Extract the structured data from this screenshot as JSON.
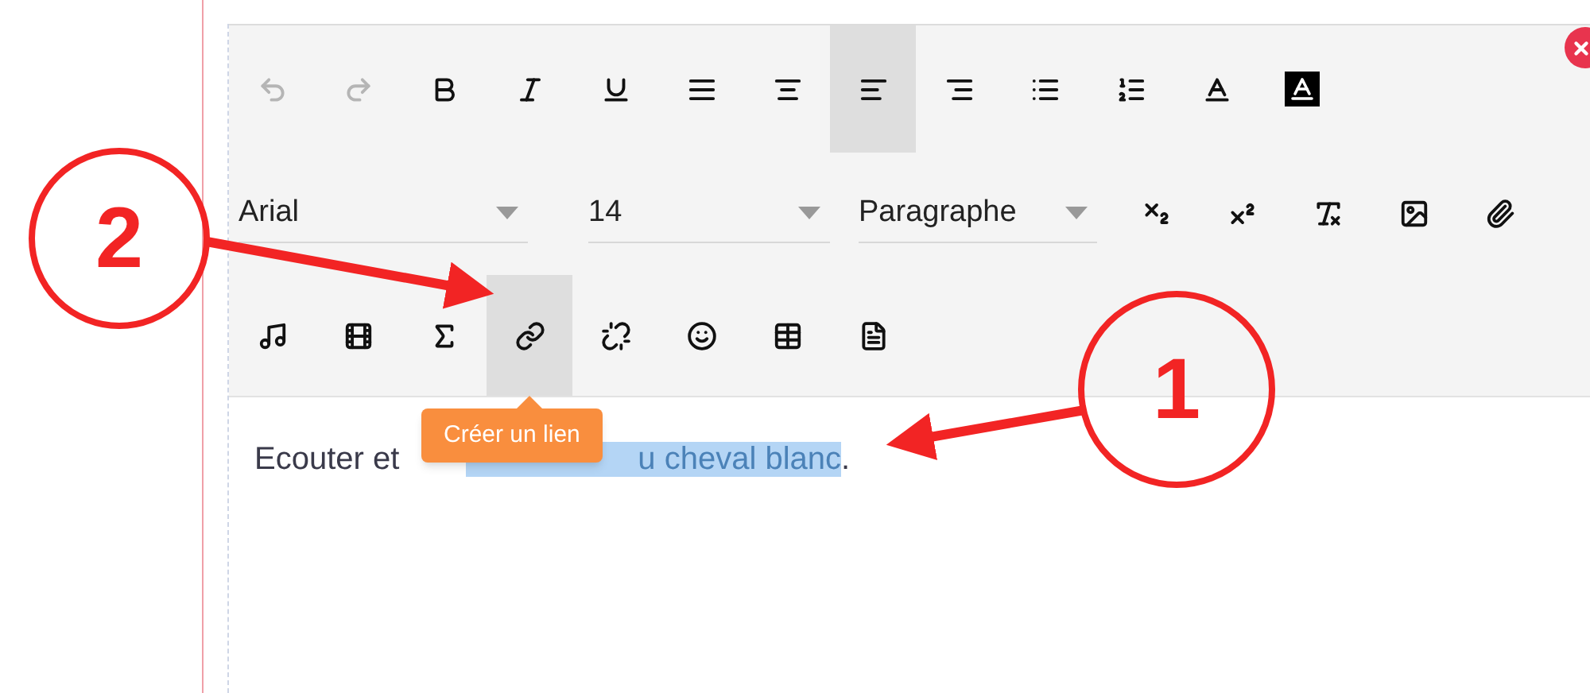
{
  "toolbar": {
    "rows": [
      {
        "buttons": [
          {
            "kind": "undo",
            "disabled": true,
            "selected": false
          },
          {
            "kind": "redo",
            "disabled": true,
            "selected": false
          },
          {
            "kind": "bold",
            "disabled": false,
            "selected": false
          },
          {
            "kind": "italic",
            "disabled": false,
            "selected": false
          },
          {
            "kind": "underline",
            "disabled": false,
            "selected": false
          },
          {
            "kind": "justify",
            "disabled": false,
            "selected": false
          },
          {
            "kind": "center",
            "disabled": false,
            "selected": false
          },
          {
            "kind": "left",
            "disabled": false,
            "selected": true
          },
          {
            "kind": "right",
            "disabled": false,
            "selected": false
          },
          {
            "kind": "bullets",
            "disabled": false,
            "selected": false
          },
          {
            "kind": "numbers",
            "disabled": false,
            "selected": false
          },
          {
            "kind": "textcolor",
            "disabled": false,
            "selected": false
          },
          {
            "kind": "bgcolor",
            "disabled": false,
            "selected": false
          }
        ]
      },
      {
        "selects": [
          {
            "value": "Arial"
          },
          {
            "value": "14"
          },
          {
            "value": "Paragraphe"
          }
        ],
        "buttons": [
          {
            "kind": "subscript",
            "disabled": false,
            "selected": false
          },
          {
            "kind": "superscript",
            "disabled": false,
            "selected": false
          },
          {
            "kind": "clearformat",
            "disabled": false,
            "selected": false
          },
          {
            "kind": "image",
            "disabled": false,
            "selected": false
          },
          {
            "kind": "attach",
            "disabled": false,
            "selected": false
          }
        ]
      },
      {
        "buttons": [
          {
            "kind": "audio",
            "disabled": false,
            "selected": false
          },
          {
            "kind": "video",
            "disabled": false,
            "selected": false
          },
          {
            "kind": "formula",
            "disabled": false,
            "selected": false
          },
          {
            "kind": "link",
            "disabled": false,
            "selected": true
          },
          {
            "kind": "unlink",
            "disabled": false,
            "selected": false
          },
          {
            "kind": "emoji",
            "disabled": false,
            "selected": false
          },
          {
            "kind": "table",
            "disabled": false,
            "selected": false
          },
          {
            "kind": "document",
            "disabled": false,
            "selected": false
          }
        ]
      }
    ]
  },
  "tooltip": "Créer un lien",
  "content": {
    "before": "Ecouter et",
    "selected": "u cheval blanc",
    "after": "."
  },
  "annotations": [
    {
      "label": "2"
    },
    {
      "label": "1"
    }
  ]
}
